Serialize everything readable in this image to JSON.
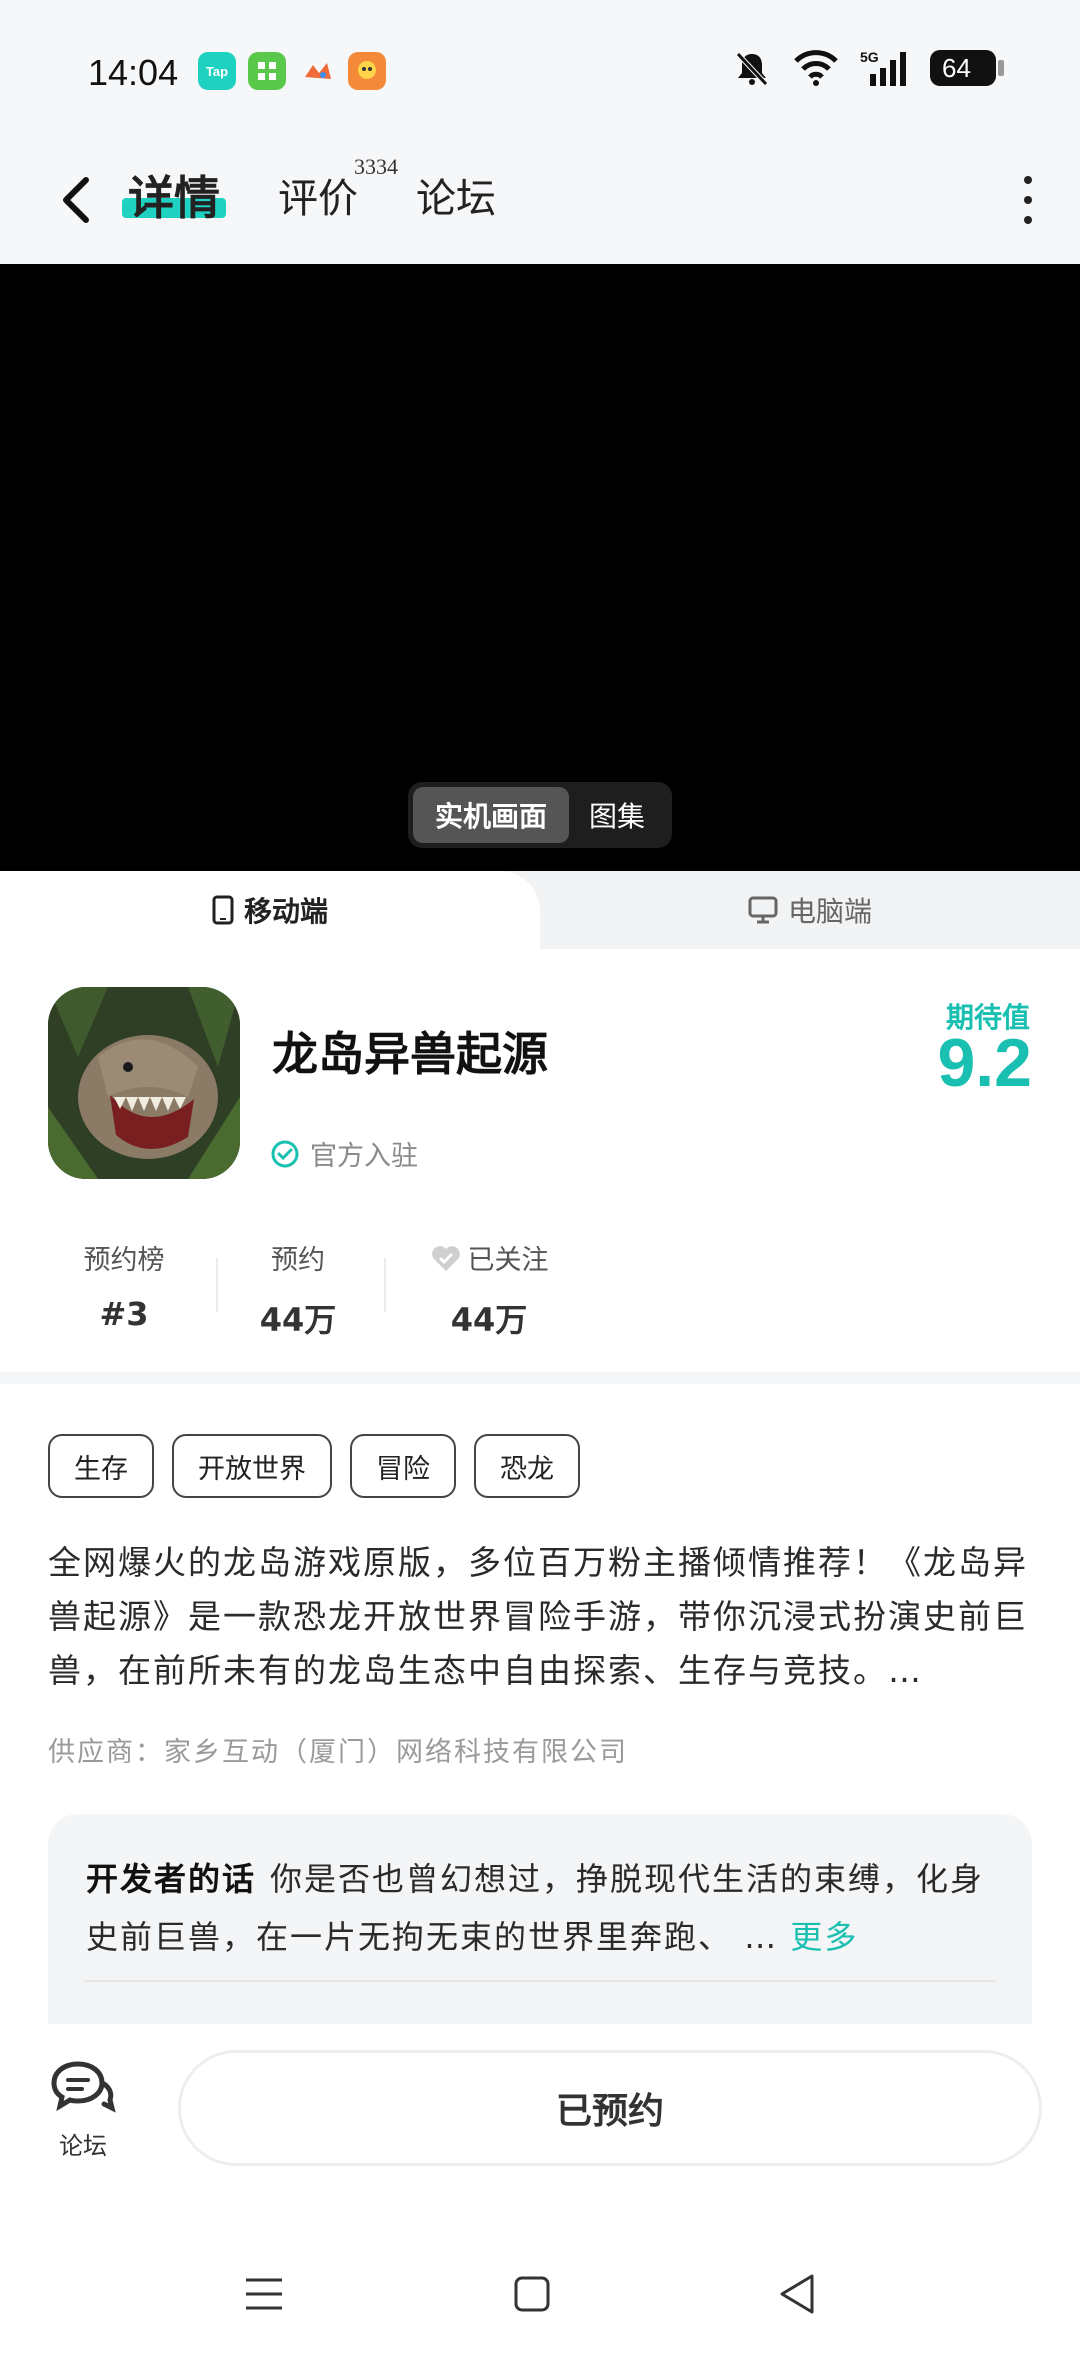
{
  "status_bar": {
    "time": "14:04",
    "app_icons": [
      {
        "name": "taptap-icon",
        "text": "Tap",
        "color": "#1fd1c0"
      },
      {
        "name": "app-store-icon",
        "text": "",
        "color": "#5ac84a"
      },
      {
        "name": "game-app-icon",
        "text": "",
        "color": "#f06a3a"
      },
      {
        "name": "points-app-icon",
        "text": "",
        "color": "#f28a3a"
      }
    ],
    "battery": "64"
  },
  "nav": {
    "tabs": [
      {
        "label": "详情",
        "active": true
      },
      {
        "label": "评价",
        "count": "3334"
      },
      {
        "label": "论坛"
      }
    ]
  },
  "media": {
    "switch_active": "实机画面",
    "switch_other": "图集"
  },
  "platform": {
    "mobile": "移动端",
    "pc": "电脑端"
  },
  "game": {
    "title": "龙岛异兽起源",
    "official": "官方入驻",
    "expect_label": "期待值",
    "expect_value": "9.2"
  },
  "stats": [
    {
      "label": "预约榜",
      "value": "#3"
    },
    {
      "label": "预约",
      "value": "44万"
    },
    {
      "label": "已关注",
      "value": "44万"
    }
  ],
  "tags": [
    "生存",
    "开放世界",
    "冒险",
    "恐龙"
  ],
  "description": "全网爆火的龙岛游戏原版，多位百万粉主播倾情推荐！《龙岛异兽起源》是一款恐龙开放世界冒险手游，带你沉浸式扮演史前巨兽，在前所未有的龙岛生态中自由探索、生存与竞技。…",
  "supplier": "供应商：家乡互动（厦门）网络科技有限公司",
  "developer": {
    "label": "开发者的话",
    "text": "你是否也曾幻想过，挣脱现代生活的束缚，化身史前巨兽，在一片无拘无束的世界里奔跑、 …",
    "more": "更多"
  },
  "bottom": {
    "forum": "论坛",
    "reserve": "已预约"
  },
  "colors": {
    "accent": "#1fd1c0",
    "accent_text": "#19bfb0"
  }
}
